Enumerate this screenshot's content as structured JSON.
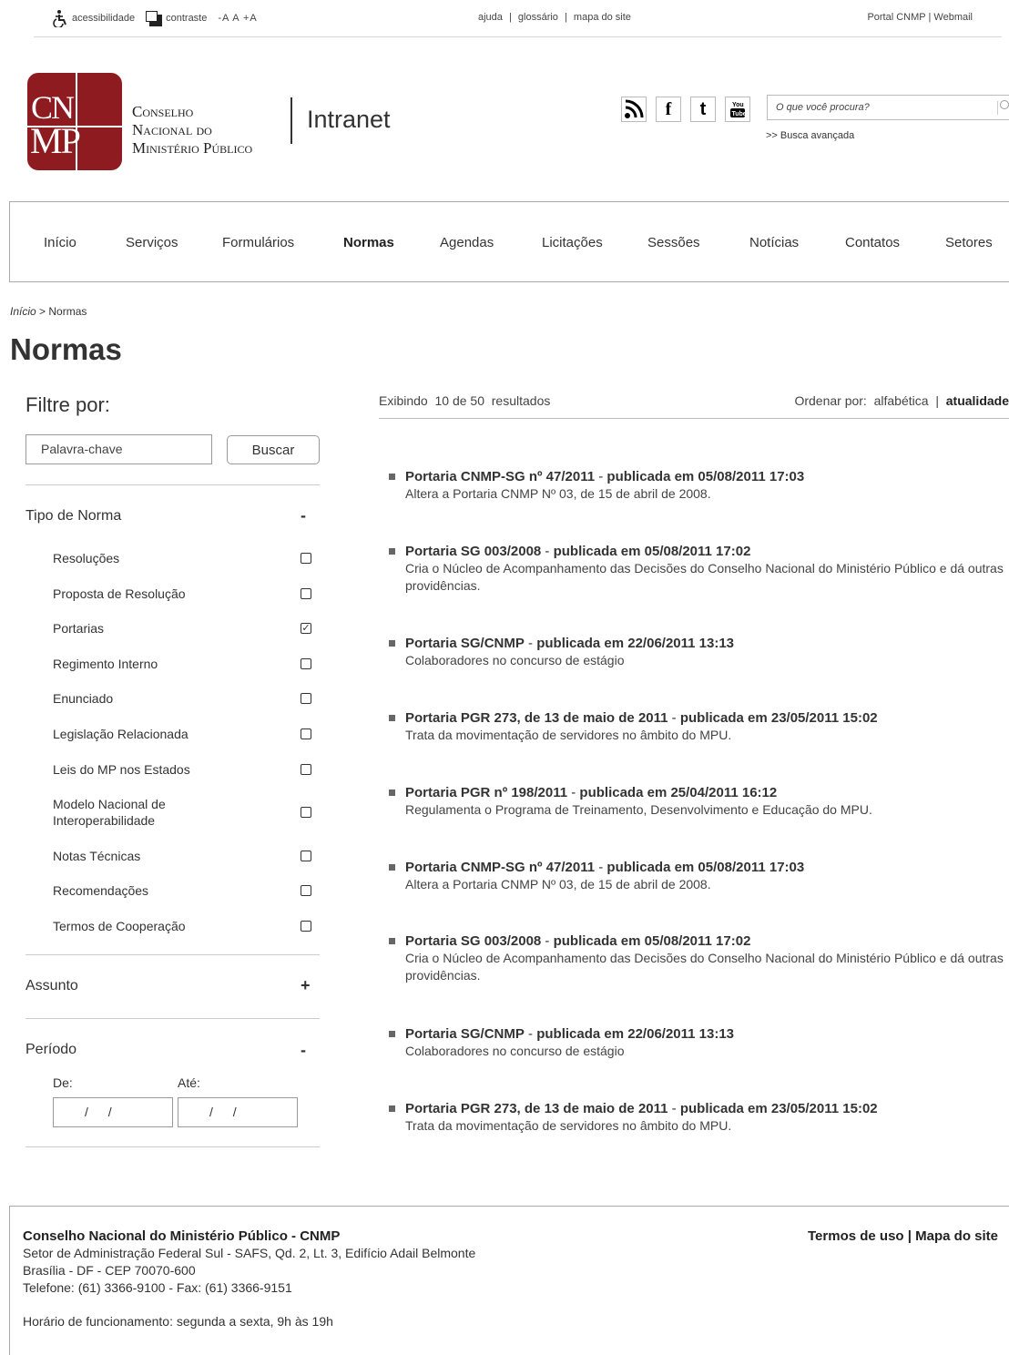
{
  "utility": {
    "accessibility": "acessibilidade",
    "contrast": "contraste",
    "font_size": "-A A +A",
    "help": "ajuda",
    "glossary": "glossário",
    "sitemap": "mapa do site",
    "portal": "Portal CNMP",
    "webmail": "Webmail",
    "sep": "|"
  },
  "header": {
    "logo_line1": "CN",
    "logo_line2": "MP",
    "org_line1": "Conselho",
    "org_line2": "Nacional do",
    "org_line3": "Ministério Público",
    "app_name": "Intranet",
    "search_placeholder": "O que você procura?",
    "advanced_search": ">> Busca avançada"
  },
  "social": [
    "rss-icon",
    "facebook-icon",
    "twitter-icon",
    "youtube-icon"
  ],
  "nav": {
    "items": [
      "Início",
      "Serviços",
      "Formulários",
      "Normas",
      "Agendas",
      "Licitações",
      "Sessões",
      "Notícias",
      "Contatos",
      "Setores"
    ],
    "active": "Normas"
  },
  "breadcrumb": {
    "home": "Início",
    "sep": ">",
    "current": "Normas"
  },
  "page_title": "Normas",
  "filters": {
    "title": "Filtre por:",
    "keyword_placeholder": "Palavra-chave",
    "search_button": "Buscar",
    "tipo_title": "Tipo de Norma",
    "tipo_toggle": "-",
    "tipo_options": [
      {
        "label": "Resoluções",
        "checked": false
      },
      {
        "label": "Proposta de Resolução",
        "checked": false
      },
      {
        "label": "Portarias",
        "checked": true
      },
      {
        "label": "Regimento Interno",
        "checked": false
      },
      {
        "label": "Enunciado",
        "checked": false
      },
      {
        "label": "Legislação Relacionada",
        "checked": false
      },
      {
        "label": "Leis do MP nos Estados",
        "checked": false
      },
      {
        "label": "Modelo Nacional de Interoperabilidade",
        "checked": false
      },
      {
        "label": "Notas Técnicas",
        "checked": false
      },
      {
        "label": "Recomendações",
        "checked": false
      },
      {
        "label": "Termos de Cooperação",
        "checked": false
      }
    ],
    "assunto_title": "Assunto",
    "assunto_toggle": "+",
    "periodo_title": "Período",
    "periodo_toggle": "-",
    "from_label": "De:",
    "to_label": "Até:",
    "from_value": "/ /",
    "to_value": "/ /"
  },
  "results": {
    "showing": "Exibindo",
    "count": "10 de 50",
    "suffix": "resultados",
    "sort_label": "Ordenar por:",
    "sort_alpha": "alfabética",
    "sort_sep": "|",
    "sort_recent": "atualidade",
    "items": [
      {
        "name": "Portaria CNMP-SG nº 47/2011",
        "published": "publicada em 05/08/2011 17:03",
        "desc": "Altera a Portaria CNMP Nº 03, de 15 de abril de 2008."
      },
      {
        "name": "Portaria SG 003/2008",
        "published": "publicada em 05/08/2011 17:02",
        "desc": "Cria o Núcleo de Acompanhamento das Decisões do Conselho Nacional do Ministério Público e dá outras providências."
      },
      {
        "name": "Portaria SG/CNMP",
        "published": "publicada em 22/06/2011 13:13",
        "desc": "Colaboradores no concurso de estágio"
      },
      {
        "name": "Portaria PGR 273, de 13 de maio de 2011",
        "published": "publicada em 23/05/2011 15:02",
        "desc": "Trata da movimentação de servidores no âmbito do MPU."
      },
      {
        "name": "Portaria PGR nº 198/2011",
        "published": "publicada em 25/04/2011 16:12",
        "desc": "Regulamenta o Programa de Treinamento, Desenvolvimento e Educação do MPU."
      },
      {
        "name": "Portaria CNMP-SG nº 47/2011",
        "published": "publicada em 05/08/2011 17:03",
        "desc": "Altera a Portaria CNMP Nº 03, de 15 de abril de 2008."
      },
      {
        "name": "Portaria SG 003/2008",
        "published": "publicada em 05/08/2011 17:02",
        "desc": "Cria o Núcleo de Acompanhamento das Decisões do Conselho Nacional do Ministério Público e dá outras providências."
      },
      {
        "name": "Portaria SG/CNMP",
        "published": "publicada em 22/06/2011 13:13",
        "desc": "Colaboradores no concurso de estágio"
      },
      {
        "name": "Portaria PGR 273, de 13 de maio de 2011",
        "published": "publicada em 23/05/2011 15:02",
        "desc": "Trata da movimentação de servidores no âmbito do MPU."
      }
    ]
  },
  "footer": {
    "org": "Conselho Nacional do Ministério Público - CNMP",
    "address1": "Setor de Administração Federal Sul - SAFS, Qd. 2, Lt. 3, Edifício Adail Belmonte",
    "address2": "Brasília - DF - CEP 70070-600",
    "phone": "Telefone: (61) 3366-9100 - Fax: (61) 3366-9151",
    "hours": "Horário de funcionamento: segunda a sexta, 9h às 19h",
    "terms": "Termos de uso",
    "sep": "|",
    "sitemap": "Mapa do site"
  }
}
